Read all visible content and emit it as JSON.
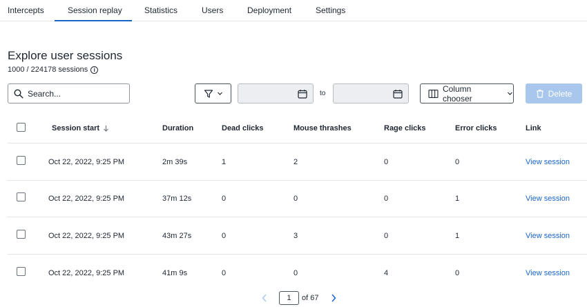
{
  "tabs": [
    {
      "label": "Intercepts"
    },
    {
      "label": "Session replay"
    },
    {
      "label": "Statistics"
    },
    {
      "label": "Users"
    },
    {
      "label": "Deployment"
    },
    {
      "label": "Settings"
    }
  ],
  "active_tab": "Session replay",
  "page": {
    "title": "Explore user sessions",
    "session_count": "1000 / 224178 sessions"
  },
  "toolbar": {
    "search_placeholder": "Search...",
    "date_from": "",
    "date_to": "",
    "to_label": "to",
    "column_chooser_label": "Column chooser",
    "delete_label": "Delete"
  },
  "table": {
    "columns": [
      "Session start",
      "Duration",
      "Dead clicks",
      "Mouse thrashes",
      "Rage clicks",
      "Error clicks",
      "Link"
    ],
    "rows": [
      {
        "session_start": "Oct 22, 2022, 9:25 PM",
        "duration": "2m 39s",
        "dead_clicks": "1",
        "mouse_thrashes": "2",
        "rage_clicks": "0",
        "error_clicks": "0",
        "link": "View session"
      },
      {
        "session_start": "Oct 22, 2022, 9:25 PM",
        "duration": "37m 12s",
        "dead_clicks": "0",
        "mouse_thrashes": "0",
        "rage_clicks": "0",
        "error_clicks": "1",
        "link": "View session"
      },
      {
        "session_start": "Oct 22, 2022, 9:25 PM",
        "duration": "43m 27s",
        "dead_clicks": "0",
        "mouse_thrashes": "3",
        "rage_clicks": "0",
        "error_clicks": "1",
        "link": "View session"
      },
      {
        "session_start": "Oct 22, 2022, 9:25 PM",
        "duration": "41m 9s",
        "dead_clicks": "0",
        "mouse_thrashes": "0",
        "rage_clicks": "4",
        "error_clicks": "0",
        "link": "View session"
      }
    ]
  },
  "pagination": {
    "current_page": "1",
    "of_label": "of 67"
  },
  "colors": {
    "accent": "#1a64c9",
    "delete_disabled": "#a9c7ec",
    "date_field_bg": "#eceef1"
  },
  "icons": {
    "search": "search-icon",
    "filter": "filter-icon",
    "calendar": "calendar-icon",
    "columns": "columns-icon",
    "trash": "trash-icon",
    "sort": "sort-desc-icon",
    "info": "info-icon"
  }
}
